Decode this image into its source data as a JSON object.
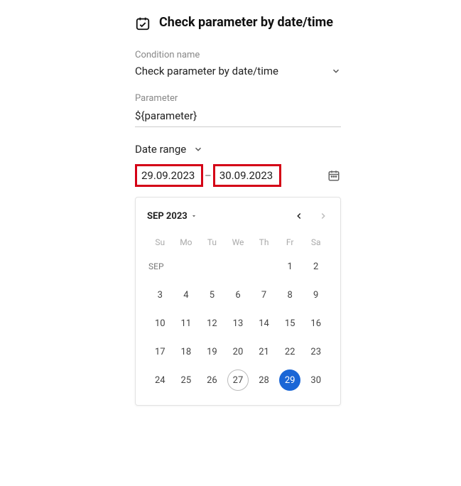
{
  "header": {
    "title": "Check parameter by date/time",
    "icon": "calendar-check-icon"
  },
  "condition": {
    "label": "Condition name",
    "value": "Check parameter by date/time"
  },
  "parameter": {
    "label": "Parameter",
    "value": "${parameter}"
  },
  "range": {
    "type_label": "Date range",
    "start": "29.09.2023",
    "end": "30.09.2023"
  },
  "calendar": {
    "month_label": "SEP 2023",
    "weekdays": [
      "Su",
      "Mo",
      "Tu",
      "We",
      "Th",
      "Fr",
      "Sa"
    ],
    "month_short": "SEP",
    "today": 27,
    "selected": 29,
    "grid": [
      [
        "",
        "",
        "",
        "",
        "",
        "1",
        "2"
      ],
      [
        "3",
        "4",
        "5",
        "6",
        "7",
        "8",
        "9"
      ],
      [
        "10",
        "11",
        "12",
        "13",
        "14",
        "15",
        "16"
      ],
      [
        "17",
        "18",
        "19",
        "20",
        "21",
        "22",
        "23"
      ],
      [
        "24",
        "25",
        "26",
        "27",
        "28",
        "29",
        "30"
      ]
    ]
  }
}
